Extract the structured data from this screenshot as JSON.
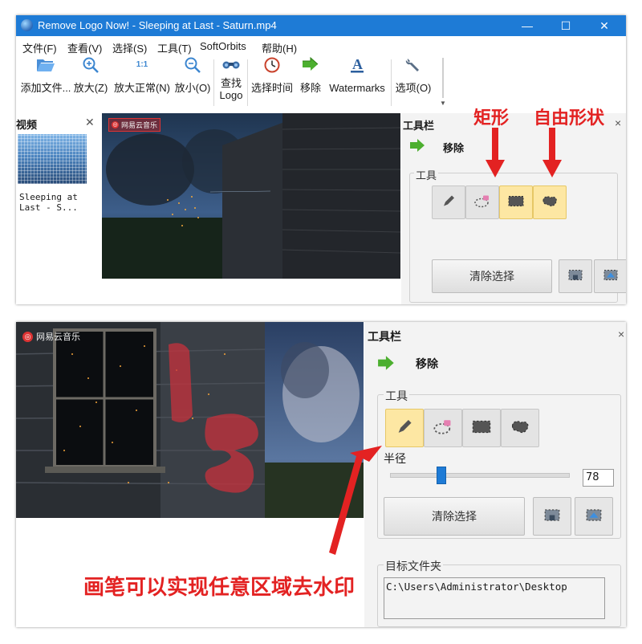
{
  "window": {
    "title": "Remove Logo Now! - Sleeping at Last - Saturn.mp4",
    "minimize_glyph": "—",
    "maximize_glyph": "☐",
    "close_glyph": "✕"
  },
  "menu": [
    "文件(F)",
    "查看(V)",
    "选择(S)",
    "工具(T)",
    "SoftOrbits",
    "帮助(H)"
  ],
  "ribbon": {
    "add_files": "添加文件...",
    "zoom_in": "放大(Z)",
    "zoom_normal": "放大正常(N)",
    "zoom_out": "放小(O)",
    "find_logo_line1": "查找",
    "find_logo_line2": "Logo",
    "select_time": "选择时间",
    "remove": "移除",
    "watermarks": "Watermarks",
    "options": "选项(O)",
    "zoom_normal_icon_text": "1:1",
    "grip_glyph": "▼"
  },
  "video_panel": {
    "title": "视频",
    "close_glyph": "✕",
    "thumbnail_caption": "Sleeping at Last - S..."
  },
  "video": {
    "watermark_text": "网易云音乐"
  },
  "toolbox": {
    "title": "工具栏",
    "close_glyph": "×",
    "remove_label": "移除",
    "tools_group": "工具",
    "clear_selection": "清除选择",
    "radius_label": "半径",
    "radius_value": "78",
    "radius_fraction": 0.27,
    "target_folder_label": "目标文件夹",
    "target_folder_path": "C:\\Users\\Administrator\\Desktop"
  },
  "annotations": {
    "rectangle": "矩形",
    "freeform": "自由形状",
    "brush_caption": "画笔可以实现任意区域去水印"
  },
  "colors": {
    "titlebar": "#1e7bd6",
    "active_tool": "#fde7a3",
    "annotation_red": "#e32222",
    "toolbox_bg": "#f3f3f3"
  }
}
